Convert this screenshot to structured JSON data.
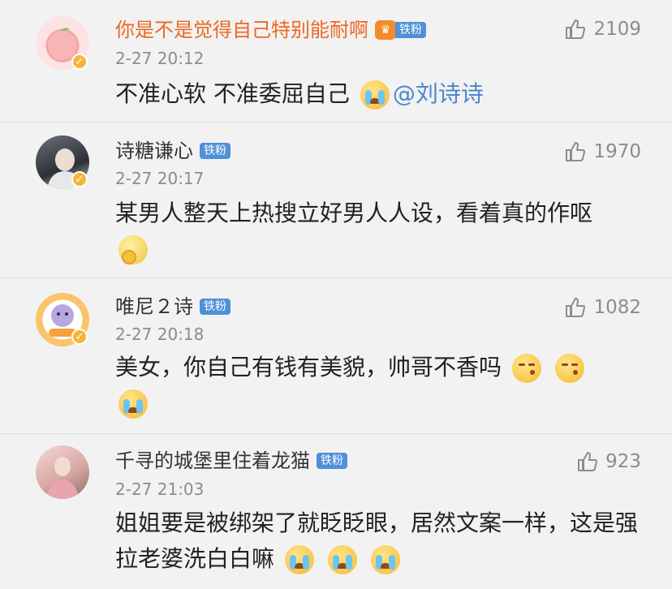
{
  "comments": [
    {
      "name": "你是不是觉得自己特别能耐啊",
      "badge": "铁粉",
      "time": "2-27 20:12",
      "likes": "2109",
      "text": "不准心软 不准委屈自己",
      "mention": "@刘诗诗",
      "emojis": [
        "crying-face"
      ]
    },
    {
      "name": "诗糖谦心",
      "badge": "铁粉",
      "time": "2-27 20:17",
      "likes": "1970",
      "text": "某男人整天上热搜立好男人人设，看着真的作呕",
      "emojis": [
        "vomit-face"
      ]
    },
    {
      "name": "唯尼２诗",
      "badge": "铁粉",
      "time": "2-27 20:18",
      "likes": "1082",
      "text": "美女，你自己有钱有美貌，帅哥不香吗",
      "emojis": [
        "kiss-face",
        "kiss-face",
        "tearful-face"
      ]
    },
    {
      "name": "千寻的城堡里住着龙猫",
      "badge": "铁粉",
      "time": "2-27 21:03",
      "likes": "923",
      "text": "姐姐要是被绑架了就眨眨眼，居然文案一样，这是强拉老婆洗白白嘛",
      "emojis": [
        "crying-face",
        "crying-face",
        "crying-face"
      ]
    }
  ],
  "colors": {
    "background": "#f2f2f2",
    "vip_name": "#ee6723",
    "fan_badge": "#4f90d8",
    "mention": "#4a86cf",
    "meta_gray": "#8c8c8c"
  }
}
